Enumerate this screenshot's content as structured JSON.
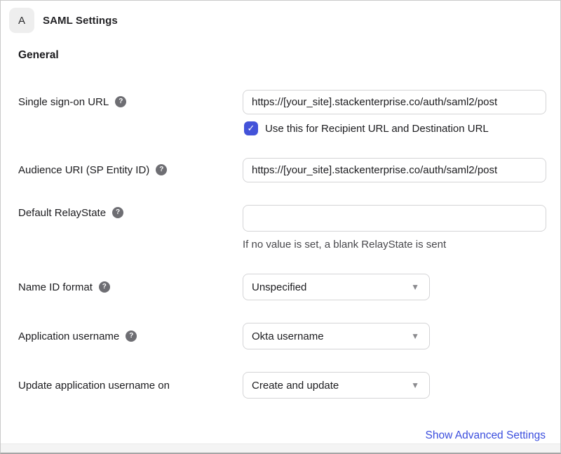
{
  "header": {
    "badge": "A",
    "title": "SAML Settings"
  },
  "section": {
    "title": "General"
  },
  "fields": {
    "sso": {
      "label": "Single sign-on URL",
      "value": "https://[your_site].stackenterprise.co/auth/saml2/post",
      "checkbox_label": "Use this for Recipient URL and Destination URL",
      "checkbox_checked": true
    },
    "audience": {
      "label": "Audience URI (SP Entity ID)",
      "value": "https://[your_site].stackenterprise.co/auth/saml2/post"
    },
    "relay": {
      "label": "Default RelayState",
      "value": "",
      "helper": "If no value is set, a blank RelayState is sent"
    },
    "nameid": {
      "label": "Name ID format",
      "selected": "Unspecified"
    },
    "appuser": {
      "label": "Application username",
      "selected": "Okta username"
    },
    "updateuser": {
      "label": "Update application username on",
      "selected": "Create and update"
    }
  },
  "footer": {
    "advanced_link": "Show Advanced Settings"
  },
  "icons": {
    "help": "?",
    "check": "✓",
    "caret": "▼"
  },
  "colors": {
    "accent": "#4353d9",
    "link": "#3b4ede",
    "badge_bg": "#eeeeee",
    "help_icon_bg": "#6e6e73",
    "input_border": "#d4d4d6"
  }
}
